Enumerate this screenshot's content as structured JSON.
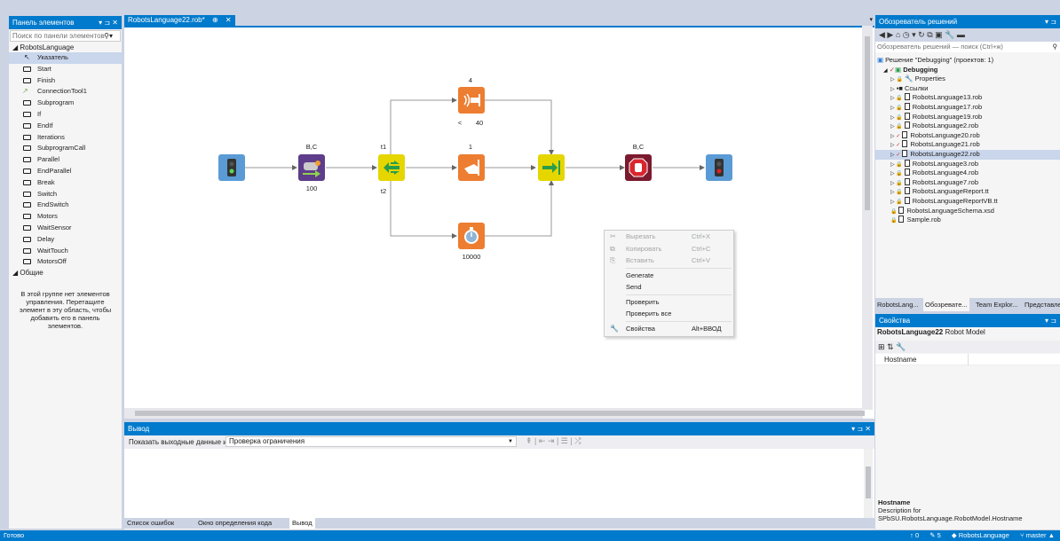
{
  "toolbox": {
    "title": "Панель элементов",
    "controls": "▾ ⊐ ✕",
    "search_placeholder": "Поиск по панели элементов",
    "group_main": "◢ RobotsLanguage",
    "items": [
      "Указатель",
      "Start",
      "Finish",
      "ConnectionTool1",
      "Subprogram",
      "If",
      "EndIf",
      "Iterations",
      "SubprogramCall",
      "Parallel",
      "EndParallel",
      "Break",
      "Switch",
      "EndSwitch",
      "Motors",
      "WaitSensor",
      "Delay",
      "WaitTouch",
      "MotorsOff"
    ],
    "group_general": "◢ Общие",
    "empty_message": "В этой группе нет элементов управления. Перетащите элемент в эту область, чтобы добавить его в панель элементов."
  },
  "editor": {
    "tab_label": "RobotsLanguage22.rob*",
    "tab_pin": "⊕",
    "tab_close": "✕",
    "dropdown": "▾"
  },
  "diagram": {
    "labels": {
      "motors_top": "B,C",
      "motors_bottom": "100",
      "switch_top": "t1",
      "switch_bottom": "t2",
      "sensor_top": "4",
      "sensor_cond_op": "<",
      "sensor_cond_val": "40",
      "touch_top": "1",
      "delay_bottom": "10000",
      "motorsoff_top": "B,C"
    },
    "colors": {
      "start_finish_bg": "#5b9bd5",
      "motors_bg": "#5e3d8a",
      "switch_bg": "#e6d600",
      "sensor_bg": "#ed7d31",
      "stop_bg": "#7b1a2e"
    }
  },
  "context_menu": {
    "items": [
      {
        "label": "Вырезать",
        "shortcut": "Ctrl+X",
        "icon": "✂",
        "disabled": true
      },
      {
        "label": "Копировать",
        "shortcut": "Ctrl+C",
        "icon": "⧉",
        "disabled": true
      },
      {
        "label": "Вставить",
        "shortcut": "Ctrl+V",
        "icon": "⎘",
        "disabled": true
      },
      {
        "label": "Generate",
        "shortcut": "",
        "icon": "",
        "disabled": false
      },
      {
        "label": "Send",
        "shortcut": "",
        "icon": "",
        "disabled": false
      },
      {
        "label": "Проверить",
        "shortcut": "",
        "icon": "",
        "disabled": false
      },
      {
        "label": "Проверить все",
        "shortcut": "",
        "icon": "",
        "disabled": false
      },
      {
        "label": "Свойства",
        "shortcut": "Alt+ВВОД",
        "icon": "🔧",
        "disabled": false
      }
    ]
  },
  "output": {
    "title": "Вывод",
    "controls": "▾ ⊐ ✕",
    "show_label": "Показать выходные данные из:",
    "source": "Проверка ограничения",
    "tabs": [
      "Список ошибок",
      "Окно определения кода",
      "Вывод"
    ]
  },
  "solution_explorer": {
    "title": "Обозреватель решений",
    "controls": "▾ ⊐",
    "toolbar": "◀ ▶ ⌂  ◷ ▾ ↻ ⧉ ▣  🔧 ▬",
    "search_placeholder": "Обозреватель решений — поиск (Ctrl+ж)",
    "solution": "Решение \"Debugging\" (проектов: 1)",
    "project": "Debugging",
    "properties": "Properties",
    "references": "Ссылки",
    "files": [
      "RobotsLanguage13.rob",
      "RobotsLanguage17.rob",
      "RobotsLanguage19.rob",
      "RobotsLanguage2.rob",
      "RobotsLanguage20.rob",
      "RobotsLanguage21.rob",
      "RobotsLanguage22.rob",
      "RobotsLanguage3.rob",
      "RobotsLanguage4.rob",
      "RobotsLanguage7.rob",
      "RobotsLanguageReport.tt",
      "RobotsLanguageReportVB.tt",
      "RobotsLanguageSchema.xsd",
      "Sample.rob"
    ],
    "tabs": [
      "RobotsLang...",
      "Обозревате...",
      "Team Explor...",
      "Представле..."
    ]
  },
  "properties": {
    "title": "Свойства",
    "controls": "▾ ⊐",
    "object_name": "RobotsLanguage22",
    "object_type": "Robot Model",
    "tools": "⊞ ⇅  🔧",
    "property_name": "Hostname",
    "desc_title": "Hostname",
    "desc_text": "Description for SPbSU.RobotsLanguage.RobotModel.Hostname"
  },
  "status": {
    "left": "Готово",
    "up": "↑ 0",
    "edits": "✎ 5",
    "repo": "◆ RobotsLanguage",
    "branch": "⑂ master ▲"
  }
}
